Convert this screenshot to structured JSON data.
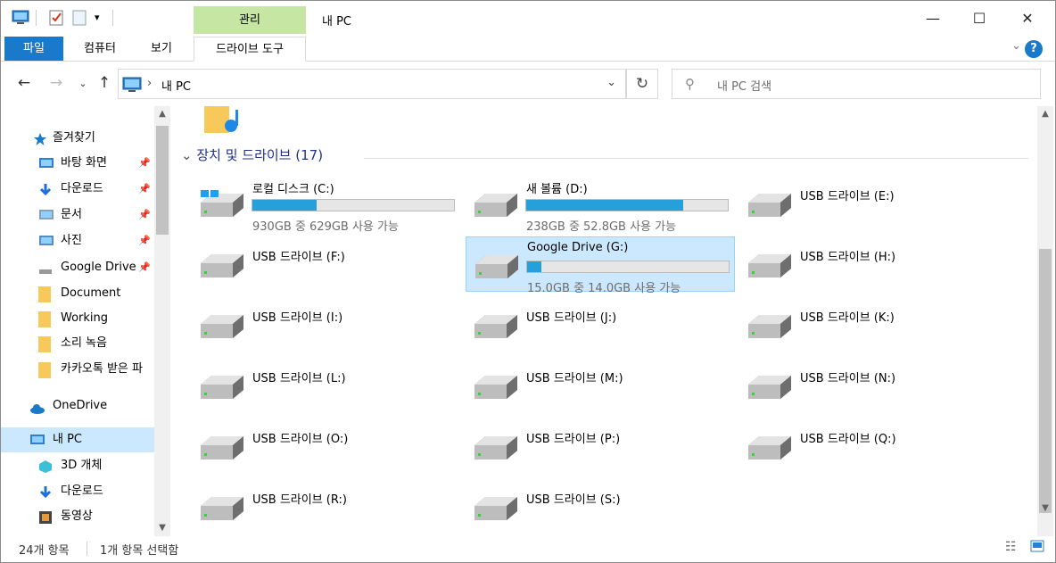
{
  "title_bar": {
    "context_tab": "관리",
    "window_title": "내 PC",
    "minimize": "—",
    "maximize": "☐",
    "close": "✕"
  },
  "ribbon": {
    "tabs": [
      "파일",
      "컴퓨터",
      "보기",
      "드라이브 도구"
    ],
    "help": "?"
  },
  "address_bar": {
    "path": "내 PC",
    "search_placeholder": "내 PC 검색"
  },
  "sidebar": {
    "items": [
      {
        "label": "즐겨찾기",
        "icon": "star-icon",
        "pinned": false
      },
      {
        "label": "바탕 화면",
        "icon": "desktop-icon",
        "pinned": true
      },
      {
        "label": "다운로드",
        "icon": "download-icon",
        "pinned": true
      },
      {
        "label": "문서",
        "icon": "document-icon",
        "pinned": true
      },
      {
        "label": "사진",
        "icon": "pictures-icon",
        "pinned": true
      },
      {
        "label": "Google Drive",
        "icon": "drive-icon",
        "pinned": true
      },
      {
        "label": "Document",
        "icon": "folder-icon",
        "pinned": false
      },
      {
        "label": "Working",
        "icon": "folder-icon",
        "pinned": false
      },
      {
        "label": "소리 녹음",
        "icon": "folder-icon",
        "pinned": false
      },
      {
        "label": "카카오톡 받은 파",
        "icon": "folder-icon",
        "pinned": false
      },
      {
        "label": "OneDrive",
        "icon": "cloud-icon",
        "pinned": false
      },
      {
        "label": "내 PC",
        "icon": "pc-icon",
        "pinned": false
      },
      {
        "label": "3D 개체",
        "icon": "cube-icon",
        "pinned": false
      },
      {
        "label": "다운로드",
        "icon": "download-icon",
        "pinned": false
      },
      {
        "label": "동영상",
        "icon": "video-icon",
        "pinned": false
      }
    ]
  },
  "content": {
    "group_title": "장치 및 드라이브 (17)",
    "drives": [
      {
        "name": "로컬 디스크 (C:)",
        "space": "930GB 중 629GB 사용 가능",
        "used_fraction": 0.32,
        "os": true
      },
      {
        "name": "새 볼륨 (D:)",
        "space": "238GB 중 52.8GB 사용 가능",
        "used_fraction": 0.78
      },
      {
        "name": "USB 드라이브 (E:)"
      },
      {
        "name": "USB 드라이브 (F:)"
      },
      {
        "name": "Google Drive (G:)",
        "space": "15.0GB 중 14.0GB 사용 가능",
        "used_fraction": 0.07,
        "selected": true
      },
      {
        "name": "USB 드라이브 (H:)"
      },
      {
        "name": "USB 드라이브 (I:)"
      },
      {
        "name": "USB 드라이브 (J:)"
      },
      {
        "name": "USB 드라이브 (K:)"
      },
      {
        "name": "USB 드라이브 (L:)"
      },
      {
        "name": "USB 드라이브 (M:)"
      },
      {
        "name": "USB 드라이브 (N:)"
      },
      {
        "name": "USB 드라이브 (O:)"
      },
      {
        "name": "USB 드라이브 (P:)"
      },
      {
        "name": "USB 드라이브 (Q:)"
      },
      {
        "name": "USB 드라이브 (R:)"
      },
      {
        "name": "USB 드라이브 (S:)"
      }
    ]
  },
  "status_bar": {
    "item_count": "24개 항목",
    "selected_count": "1개 항목 선택함"
  },
  "colors": {
    "accent": "#1979ca",
    "context_tab": "#c5e7a3",
    "selection": "#cce8ff",
    "usage_bar": "#26a0da"
  }
}
